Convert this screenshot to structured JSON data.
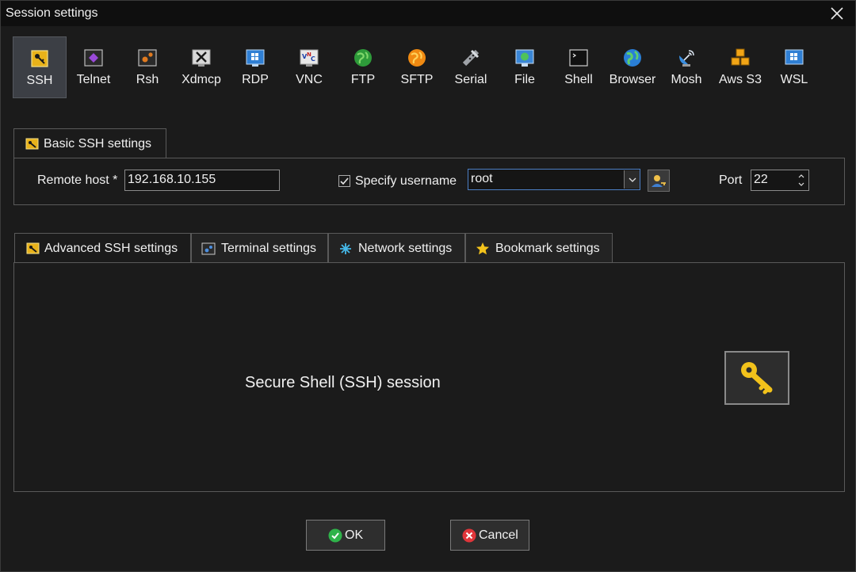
{
  "window": {
    "title": "Session settings"
  },
  "session_types": [
    {
      "label": "SSH",
      "icon": "ssh-key-icon",
      "selected": true
    },
    {
      "label": "Telnet",
      "icon": "telnet-icon"
    },
    {
      "label": "Rsh",
      "icon": "rsh-icon"
    },
    {
      "label": "Xdmcp",
      "icon": "xdmcp-icon"
    },
    {
      "label": "RDP",
      "icon": "rdp-icon"
    },
    {
      "label": "VNC",
      "icon": "vnc-icon"
    },
    {
      "label": "FTP",
      "icon": "ftp-globe-icon"
    },
    {
      "label": "SFTP",
      "icon": "sftp-globe-icon"
    },
    {
      "label": "Serial",
      "icon": "serial-plug-icon"
    },
    {
      "label": "File",
      "icon": "file-monitor-icon"
    },
    {
      "label": "Shell",
      "icon": "shell-terminal-icon"
    },
    {
      "label": "Browser",
      "icon": "browser-globe-icon"
    },
    {
      "label": "Mosh",
      "icon": "mosh-satellite-icon"
    },
    {
      "label": "Aws S3",
      "icon": "aws-s3-cubes-icon"
    },
    {
      "label": "WSL",
      "icon": "wsl-windows-icon"
    }
  ],
  "basic": {
    "tab_label": "Basic SSH settings",
    "remote_host_label": "Remote host *",
    "remote_host_value": "192.168.10.155",
    "specify_username_label": "Specify username",
    "specify_username_checked": true,
    "username_value": "root",
    "port_label": "Port",
    "port_value": "22"
  },
  "advanced_tabs": [
    {
      "label": "Advanced SSH settings",
      "icon": "wrench-key-icon"
    },
    {
      "label": "Terminal settings",
      "icon": "terminal-gear-icon"
    },
    {
      "label": "Network settings",
      "icon": "network-icon"
    },
    {
      "label": "Bookmark settings",
      "icon": "star-icon"
    }
  ],
  "content": {
    "description": "Secure Shell (SSH) session"
  },
  "buttons": {
    "ok": "OK",
    "cancel": "Cancel"
  },
  "colors": {
    "accent_key": "#f2c21b",
    "ok_green": "#2fb34a",
    "cancel_red": "#e0353a",
    "selected_bg": "#3c3f45"
  }
}
